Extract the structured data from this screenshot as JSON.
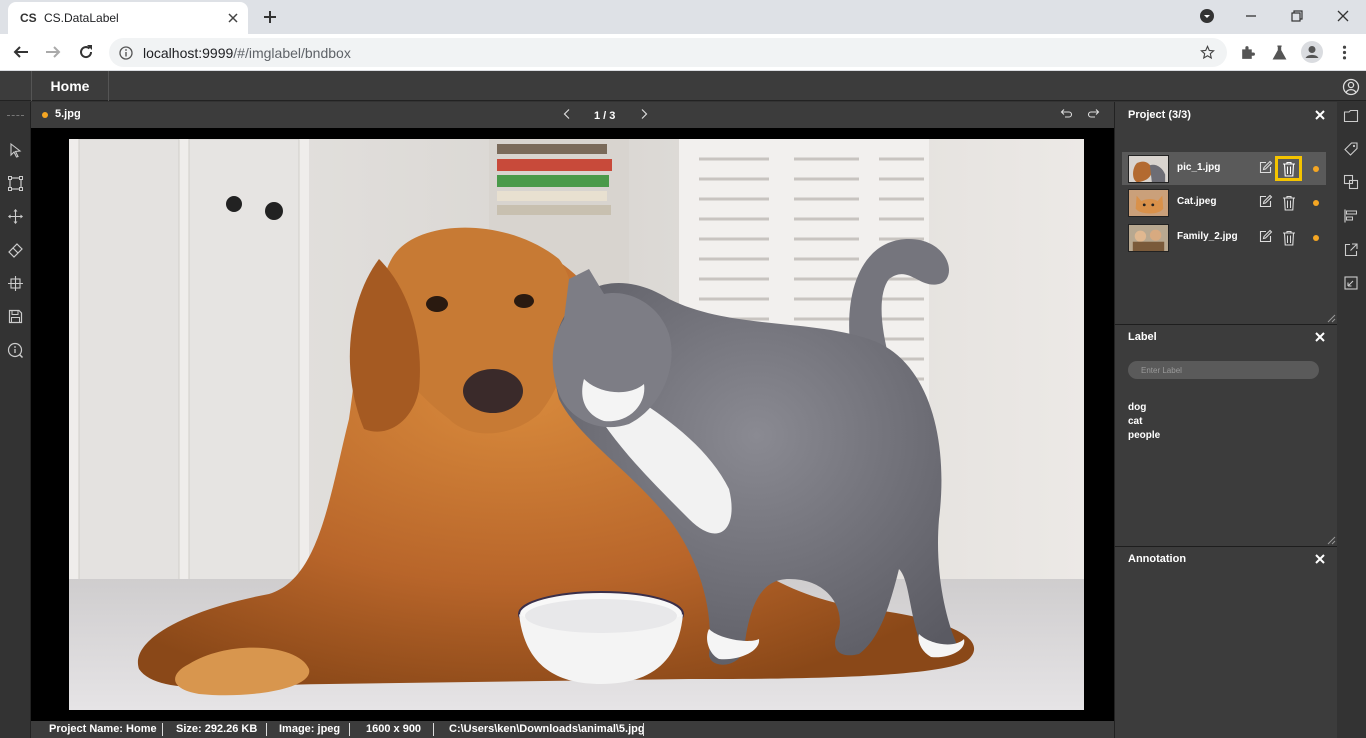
{
  "browser": {
    "tab": {
      "favicon": "CS",
      "title": "CS.DataLabel"
    },
    "url": {
      "host": "localhost:9999",
      "path": "/#/imglabel/bndbox"
    },
    "icons": [
      "close-icon",
      "plus-icon",
      "minimize-icon",
      "restore-icon",
      "back-icon",
      "forward-icon",
      "reload-icon",
      "info-icon",
      "star-icon",
      "extensions-icon",
      "labs-icon",
      "profile-icon",
      "kebab-icon"
    ]
  },
  "app": {
    "menu": {
      "home": "Home"
    },
    "viewer": {
      "file_name": "5.jpg",
      "pager": "1 / 3"
    },
    "status": {
      "project_name": "Project Name: Home",
      "size": "Size: 292.26 KB",
      "image_type": "Image: jpeg",
      "dimensions": "1600 x 900",
      "path": "C:\\Users\\ken\\Downloads\\animal\\5.jpg"
    },
    "project_panel": {
      "title": "Project (3/3)",
      "items": [
        {
          "name": "pic_1.jpg",
          "active": true
        },
        {
          "name": "Cat.jpeg",
          "active": false
        },
        {
          "name": "Family_2.jpg",
          "active": false
        }
      ]
    },
    "label_panel": {
      "title": "Label",
      "placeholder": "Enter Label",
      "labels": [
        "dog",
        "cat",
        "people"
      ]
    },
    "annotation_panel": {
      "title": "Annotation"
    },
    "colors": {
      "accent_dot": "#f5a623",
      "highlight_border": "#f5c400",
      "panel_bg": "#3c3c3c",
      "canvas_bg": "#000000"
    }
  }
}
